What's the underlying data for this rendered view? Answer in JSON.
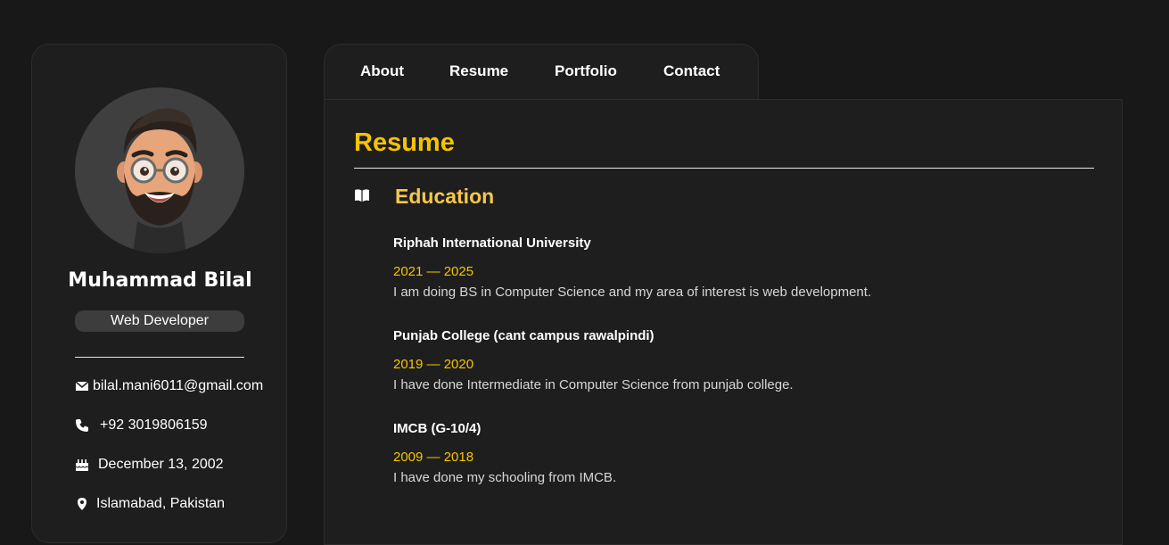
{
  "profile": {
    "name": "Muhammad Bilal",
    "role": "Web Developer",
    "avatar_icon": "memoji-avatar-icon"
  },
  "contacts": [
    {
      "icon": "envelope-icon",
      "value": "bilal.mani6011@gmail.com"
    },
    {
      "icon": "phone-icon",
      "value": "+92 3019806159"
    },
    {
      "icon": "birthday-cake-icon",
      "value": "December 13, 2002"
    },
    {
      "icon": "location-pin-icon",
      "value": "Islamabad, Pakistan"
    }
  ],
  "nav": {
    "tabs": [
      "About",
      "Resume",
      "Portfolio",
      "Contact"
    ]
  },
  "resume": {
    "title": "Resume",
    "section_title": "Education",
    "section_icon": "book-icon",
    "items": [
      {
        "institution": "Riphah International University",
        "years": "2021 — 2025",
        "description": "I am doing BS in Computer Science and my area of interest is web development."
      },
      {
        "institution": "Punjab College (cant campus rawalpindi)",
        "years": "2019 — 2020",
        "description": "I have done Intermediate in Computer Science from punjab college."
      },
      {
        "institution": "IMCB (G-10/4)",
        "years": "2009 — 2018",
        "description": "I have done my schooling from IMCB."
      }
    ]
  },
  "colors": {
    "background": "#181818",
    "card": "#1e1e1f",
    "accent": "#f5c400",
    "accent_light": "#f5c84c"
  }
}
